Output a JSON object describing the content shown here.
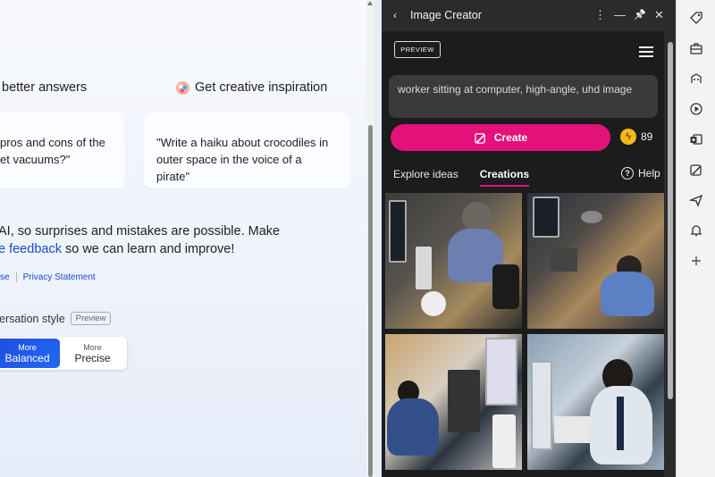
{
  "chat": {
    "heading_answers": "better answers",
    "heading_inspiration": "Get creative inspiration",
    "card1_line1": "pros and cons of the",
    "card1_line2": "et vacuums?\"",
    "card2_line1": "\"Write a haiku about crocodiles in",
    "card2_line2": "outer space in the voice of a pirate\"",
    "disclaimer_line1": "AI, so surprises and mistakes are possible. Make",
    "disclaimer_link": "e feedback",
    "disclaimer_rest": " so we can learn and improve!",
    "link_terms": "se",
    "link_privacy": "Privacy Statement",
    "conversation_style_label": "ersation style",
    "preview_badge": "Preview",
    "style_balanced_small": "More",
    "style_balanced": "Balanced",
    "style_precise_small": "More",
    "style_precise": "Precise"
  },
  "image_creator": {
    "title": "Image Creator",
    "back_glyph": "‹",
    "more_glyph": "⋮",
    "minimize_glyph": "—",
    "pin_glyph": "📌",
    "close_glyph": "✕",
    "preview_label": "PREVIEW",
    "prompt_text": "worker sitting at computer, high-angle, uhd image",
    "create_label": "Create",
    "boost_count": "89",
    "tabs": [
      "Explore ideas",
      "Creations"
    ],
    "active_tab": "Creations",
    "help_label": "Help"
  },
  "sidebar": {
    "icons": [
      "tag-icon",
      "toolbox-icon",
      "games-icon",
      "play-icon",
      "outlook-icon",
      "image-creator-icon",
      "send-icon",
      "bell-icon",
      "add-icon"
    ]
  },
  "colors": {
    "accent_pink": "#e3117a",
    "link_blue": "#1b4bd1",
    "balanced_blue": "#1d4fe0"
  }
}
